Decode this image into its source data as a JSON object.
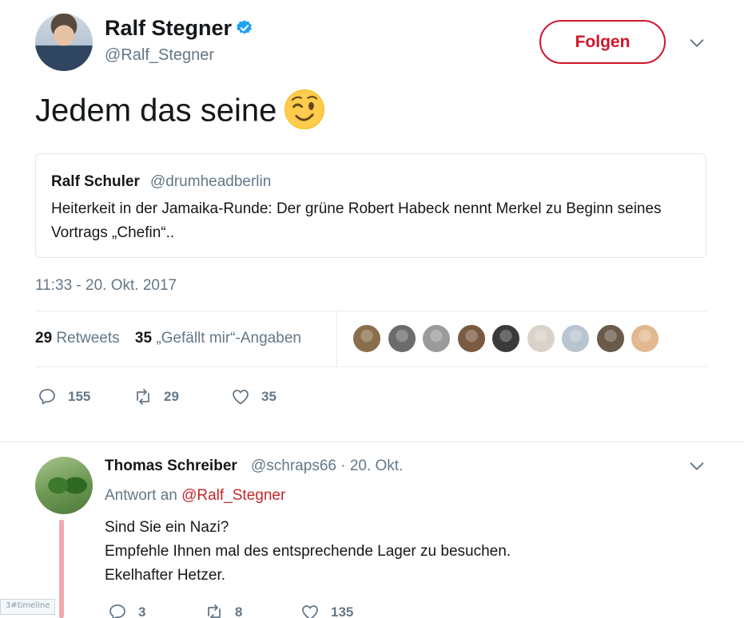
{
  "tweet": {
    "author_name": "Ralf Stegner",
    "author_handle": "@Ralf_Stegner",
    "follow_label": "Folgen",
    "text": "Jedem das seine",
    "emoji": "winking-face",
    "quote": {
      "name": "Ralf Schuler",
      "handle": "@drumheadberlin",
      "text": "Heiterkeit in der Jamaika-Runde: Der grüne Robert Habeck nennt Merkel zu Beginn seines Vortrags „Chefin“.."
    },
    "timestamp": "11:33 - 20. Okt. 2017",
    "stats": {
      "retweets_count": "29",
      "retweets_label": "Retweets",
      "likes_count": "35",
      "likes_label": "„Gefällt mir“-Angaben"
    },
    "liker_avatars": [
      "#8a6e4b",
      "#6b6b6b",
      "#9a9a9a",
      "#7a5a40",
      "#3a3a3a",
      "#d9d2c8",
      "#b8c4cf",
      "#6a5a4a",
      "#e2b890"
    ],
    "actions": {
      "replies": "155",
      "retweets": "29",
      "likes": "35"
    }
  },
  "reply": {
    "author_name": "Thomas Schreiber",
    "meta": "@schraps66 · 20. Okt.",
    "reply_to_prefix": "Antwort an",
    "reply_to_mention": "@Ralf_Stegner",
    "lines": [
      "Sind Sie ein Nazi?",
      "Empfehle Ihnen mal des entsprechende Lager zu besuchen.",
      "Ekelhafter Hetzer."
    ],
    "actions": {
      "replies": "3",
      "retweets": "8",
      "likes": "135"
    }
  },
  "timeline_badge": "3#timeline",
  "colors": {
    "accent": "#d0162a",
    "verified": "#1da1f2",
    "muted": "#657786",
    "thread_line": "#f3a8b0"
  }
}
